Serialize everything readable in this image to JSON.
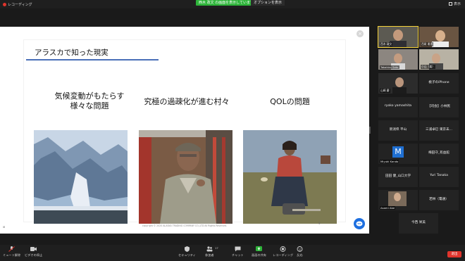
{
  "topbar": {
    "recording_label": "レコーディング",
    "share_banner": "西木 政文 の画面を表示しています",
    "view_options": "オプションを表示",
    "view_label": "表示"
  },
  "slide": {
    "title": "アラスカで知った現実",
    "col1_line1": "気候変動がもたらす",
    "col1_line2": "様々な問題",
    "col2": "究極の過疎化が進む村々",
    "col3": "QOLの問題",
    "copyright": "copyright © 2020 ALASKA TRADING COMPANY CO.,LTD All Rights Reserved.",
    "page_number": "9"
  },
  "participants": [
    {
      "name": "西木 政文",
      "video": true
    },
    {
      "name": "西尾 雅恵",
      "video": true
    },
    {
      "name": "Takahiro Sato",
      "video": true
    },
    {
      "name": "小山（楽）",
      "video": true
    },
    {
      "name": "山崎 慶",
      "video": true
    },
    {
      "name": "桃子のiPhone",
      "video": false
    },
    {
      "name": "ryoko yamashita",
      "video": false
    },
    {
      "name": "【司会】小林民",
      "video": false
    },
    {
      "name": "新潟県 平山",
      "video": false
    },
    {
      "name": "三浦卓巳 東京未...",
      "video": false
    },
    {
      "name": "Miyuki Kando",
      "video": false,
      "avatar_letter": "M"
    },
    {
      "name": "梅田守_有益館",
      "video": false
    },
    {
      "name": "田田 健_山口大学",
      "video": false
    },
    {
      "name": "Yuri Tanaka",
      "video": false
    },
    {
      "name": "Asami Abe",
      "video": true
    },
    {
      "name": "若林（電通）",
      "video": false
    },
    {
      "name": "今西 栄美",
      "video": false
    }
  ],
  "toolbar": {
    "mute": "ミュート解除",
    "video": "ビデオの停止",
    "security": "セキュリティ",
    "participants": "参加者",
    "participants_count": "17",
    "chat": "チャット",
    "share": "画面の共有",
    "record": "レコーディング",
    "reactions": "反応",
    "end": "退出"
  },
  "colors": {
    "share_green": "#2eb53a",
    "record_red": "#e0342c",
    "accent_blue": "#1d6fe0",
    "title_underline": "#4a6fb8"
  }
}
